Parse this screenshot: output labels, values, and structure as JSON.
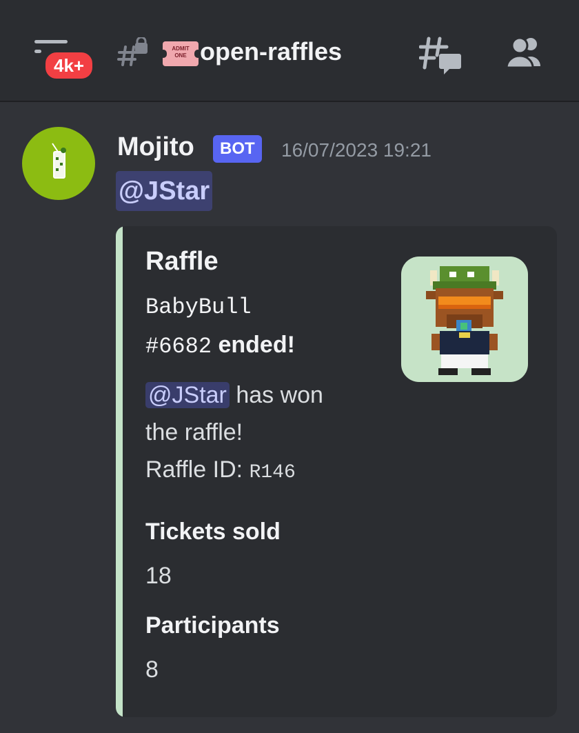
{
  "header": {
    "badge": "4k+",
    "ticket_text_1": "ADMIT",
    "ticket_text_2": "ONE",
    "channel_name": "open-raffles",
    "icons": [
      "menu-icon",
      "locked-hash-icon",
      "admission-ticket-icon",
      "threads-icon",
      "members-icon"
    ]
  },
  "message": {
    "username": "Mojito",
    "bot_tag": "BOT",
    "timestamp": "16/07/2023 19:21",
    "mention": "@JStar",
    "avatar_icon": "mojito-glass-icon"
  },
  "embed": {
    "accent_color": "#c4e3c8",
    "title": "Raffle",
    "nft_name": "BabyBull",
    "nft_number": "#6682",
    "ended": "ended!",
    "winner_mention": "@JStar",
    "won_text": "has won",
    "won_text_2": "the raffle!",
    "raffle_id_label": "Raffle ID:",
    "raffle_id": "R146",
    "thumbnail_icon": "pixel-bull-nft-image",
    "fields": [
      {
        "name": "Tickets sold",
        "value": "18"
      },
      {
        "name": "Participants",
        "value": "8"
      }
    ]
  },
  "colors": {
    "background": "#313338",
    "header": "#2b2d31",
    "badge": "#f23f43",
    "bot_tag": "#5865f2",
    "mention_text": "#c9cdfb"
  }
}
